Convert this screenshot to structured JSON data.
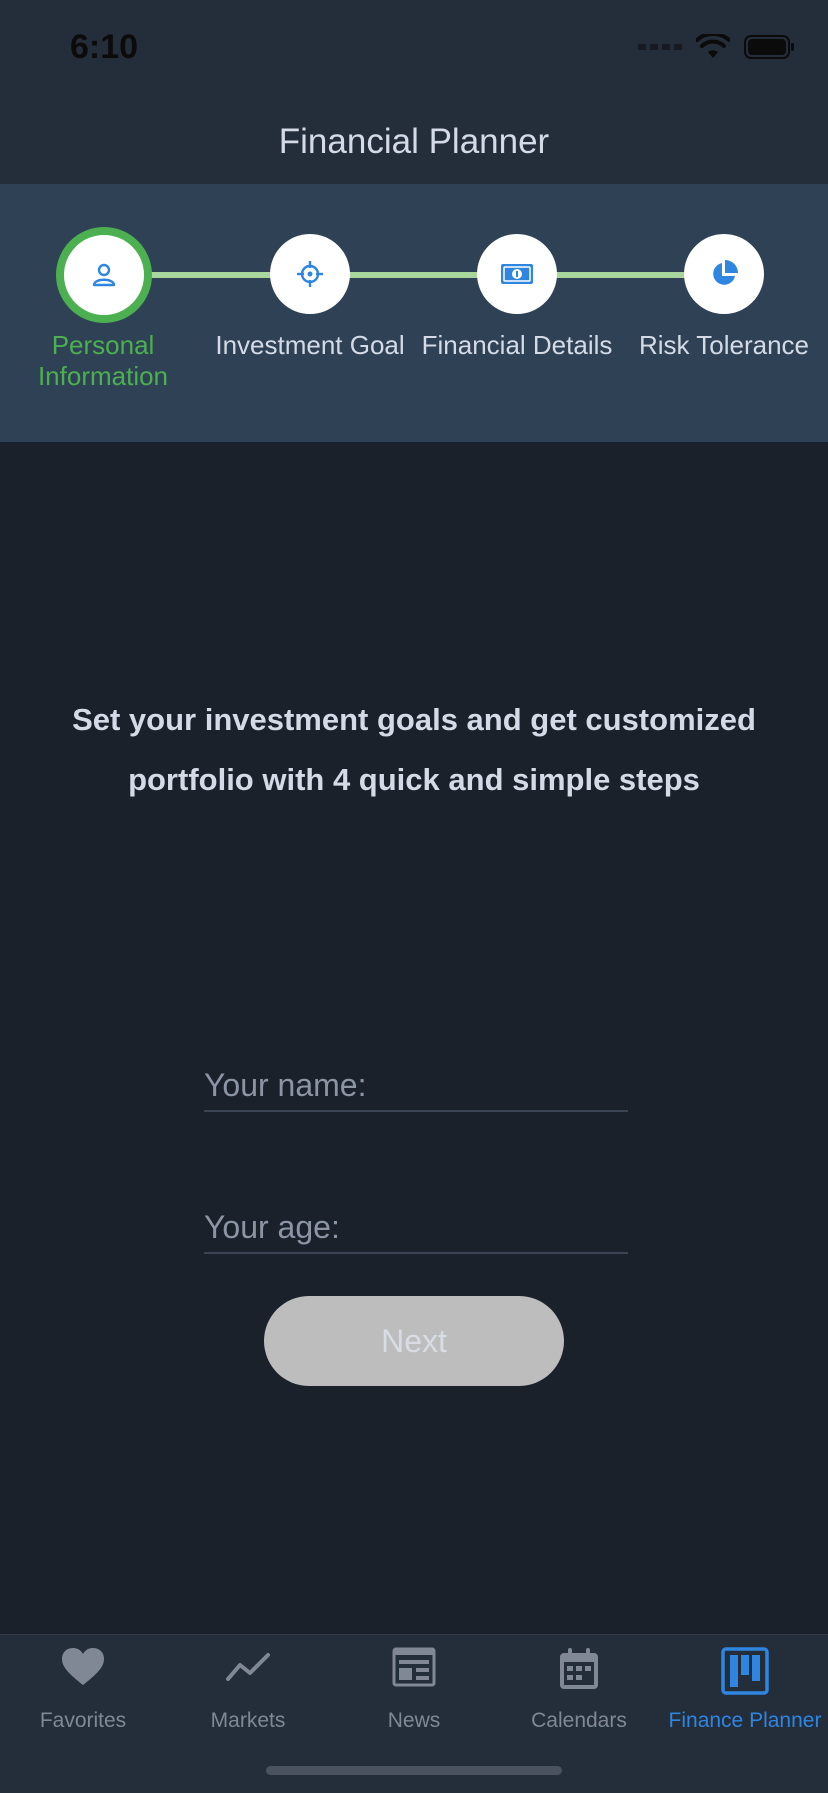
{
  "status": {
    "time": "6:10"
  },
  "header": {
    "title": "Financial Planner"
  },
  "steps": [
    {
      "label": "Personal Information",
      "icon": "person-icon",
      "active": true
    },
    {
      "label": "Investment Goal",
      "icon": "crosshair-icon",
      "active": false
    },
    {
      "label": "Financial Details",
      "icon": "banknote-icon",
      "active": false
    },
    {
      "label": "Risk Tolerance",
      "icon": "pie-chart-icon",
      "active": false
    }
  ],
  "intro": {
    "text": "Set your investment goals and get customized portfolio with 4 quick and simple steps"
  },
  "form": {
    "name_placeholder": "Your name:",
    "name_value": "",
    "age_placeholder": "Your age:",
    "age_value": "",
    "next_label": "Next"
  },
  "tabs": [
    {
      "label": "Favorites",
      "icon": "heart-icon",
      "active": false
    },
    {
      "label": "Markets",
      "icon": "trend-line-icon",
      "active": false
    },
    {
      "label": "News",
      "icon": "newspaper-icon",
      "active": false
    },
    {
      "label": "Calendars",
      "icon": "calendar-icon",
      "active": false
    },
    {
      "label": "Finance Planner",
      "icon": "kanban-icon",
      "active": true
    }
  ],
  "colors": {
    "background": "#1b212b",
    "header": "#242d3a",
    "stepper": "#2f4255",
    "active_green": "#4caf50",
    "connector": "#a9d69c",
    "accent_blue": "#2f86e0",
    "disabled_button": "#bdbdbd"
  }
}
